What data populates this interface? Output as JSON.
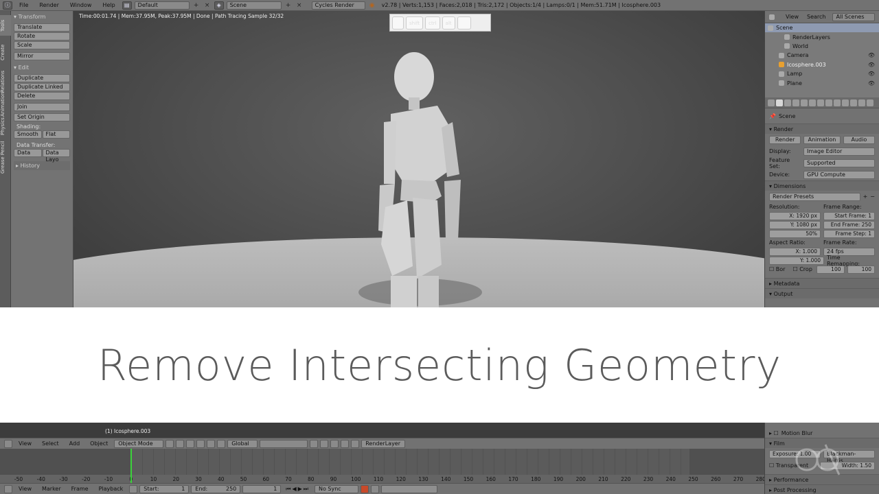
{
  "topbar": {
    "menus": [
      "File",
      "Render",
      "Window",
      "Help"
    ],
    "layout": "Default",
    "scene": "Scene",
    "engine": "Cycles Render",
    "info": "v2.78 | Verts:1,153 | Faces:2,018 | Tris:2,172 | Objects:1/4 | Lamps:0/1 | Mem:51.71M | Icosphere.003"
  },
  "tabs": [
    "Tools",
    "Create",
    "Relations",
    "Animation",
    "Physics",
    "Grease Pencil"
  ],
  "shelf": {
    "transform_header": "Transform",
    "translate": "Translate",
    "rotate": "Rotate",
    "scale": "Scale",
    "mirror": "Mirror",
    "edit_header": "Edit",
    "duplicate": "Duplicate",
    "duplicate_linked": "Duplicate Linked",
    "delete": "Delete",
    "join": "Join",
    "set_origin": "Set Origin",
    "shading_label": "Shading:",
    "smooth": "Smooth",
    "flat": "Flat",
    "data_transfer_label": "Data Transfer:",
    "data": "Data",
    "data_layout": "Data Layo",
    "history_header": "History"
  },
  "viewport": {
    "status": "Time:00:01.74 | Mem:37.95M, Peak:37.95M | Done | Path Tracing Sample 32/32",
    "keys": [
      "",
      "shift",
      "ctrl",
      "alt",
      ""
    ],
    "object_name": "(1) Icosphere.003"
  },
  "outliner": {
    "view": "View",
    "search": "Search",
    "scenes": "All Scenes",
    "rows": [
      "Scene",
      "RenderLayers",
      "World",
      "Camera",
      "Icosphere.003",
      "Lamp",
      "Plane"
    ]
  },
  "props": {
    "context": "Scene",
    "render_header": "Render",
    "render_btn": "Render",
    "animation_btn": "Animation",
    "audio_btn": "Audio",
    "display_label": "Display:",
    "display_value": "Image Editor",
    "feature_label": "Feature Set:",
    "feature_value": "Supported",
    "device_label": "Device:",
    "device_value": "GPU Compute",
    "dimensions_header": "Dimensions",
    "presets": "Render Presets",
    "resolution_label": "Resolution:",
    "res_x": "1920 px",
    "res_y": "1080 px",
    "res_pct": "50%",
    "frame_range_label": "Frame Range:",
    "start_frame": "Start Frame: 1",
    "end_frame": "End Frame: 250",
    "frame_step": "Frame Step: 1",
    "aspect_label": "Aspect Ratio:",
    "aspect_x": "1.000",
    "aspect_y": "1.000",
    "frame_rate_label": "Frame Rate:",
    "frame_rate": "24 fps",
    "time_remap_label": "Time Remapping:",
    "remap_old": "100",
    "remap_new": "100",
    "bor": "Bor",
    "crop": "Crop",
    "metadata_header": "Metadata",
    "output_header": "Output",
    "motion_blur": "Motion Blur",
    "film_header": "Film",
    "exposure": "Exposure: 1.00",
    "filter": "Blackman-Harris",
    "transparent": "Transparent",
    "width": "Width:",
    "width_value": "1.50",
    "performance": "Performance",
    "post_processing": "Post Processing"
  },
  "banner": {
    "title": "Remove Intersecting Geometry"
  },
  "header3d": {
    "menus": [
      "View",
      "Select",
      "Add",
      "Object"
    ],
    "mode": "Object Mode",
    "orientation": "Global",
    "render_layer": "RenderLayer"
  },
  "timeline": {
    "ticks": [
      "-50",
      "-40",
      "-30",
      "-20",
      "-10",
      "0",
      "10",
      "20",
      "30",
      "40",
      "50",
      "60",
      "70",
      "80",
      "90",
      "100",
      "110",
      "120",
      "130",
      "140",
      "150",
      "160",
      "170",
      "180",
      "190",
      "200",
      "210",
      "220",
      "230",
      "240",
      "250",
      "260",
      "270",
      "280"
    ],
    "menus": [
      "View",
      "Marker",
      "Frame",
      "Playback"
    ],
    "start": "Start:",
    "start_value": "1",
    "end": "End:",
    "end_value": "250",
    "current": "1",
    "sync": "No Sync"
  }
}
